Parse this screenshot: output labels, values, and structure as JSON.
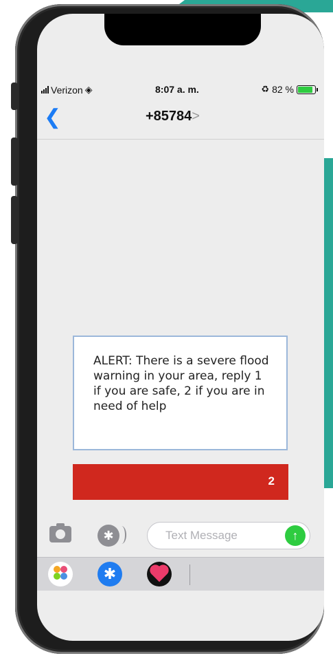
{
  "status_bar": {
    "carrier": "Verizon",
    "time": "8:07 a. m.",
    "battery_label": "82 %",
    "battery_level": 0.82
  },
  "nav": {
    "back_icon": "chevron-left-icon",
    "contact": "+85784",
    "contact_chevron": ">"
  },
  "message": {
    "text": "ALERT: There is a severe flood warning in your area, reply 1 if you are safe, 2 if you are in need of help"
  },
  "reply": {
    "label": "2",
    "color": "#d0281e"
  },
  "input": {
    "placeholder": "Text Message",
    "send_icon": "arrow-up-icon",
    "camera_icon": "camera-icon",
    "apps_icon": "app-store-icon"
  },
  "tray": {
    "items": [
      "photos-icon",
      "app-store-icon",
      "heart-app-icon"
    ]
  },
  "colors": {
    "accent": "#1b7cf5",
    "send": "#2ecc40",
    "teal_background": "#2aa796"
  }
}
